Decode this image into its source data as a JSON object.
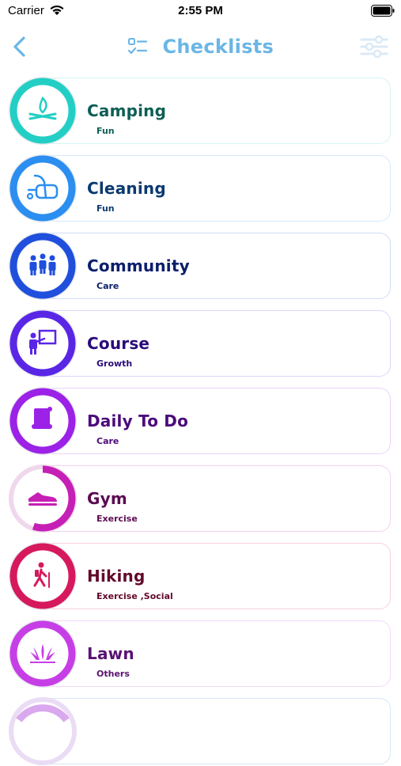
{
  "status": {
    "carrier": "Carrier",
    "time": "2:55 PM"
  },
  "nav": {
    "title": "Checklists"
  },
  "items": [
    {
      "name": "Camping",
      "category": "Fun",
      "color": "#23cfc4",
      "text_color": "#0d5f55",
      "icon": "campfire-icon",
      "progress": 1.0
    },
    {
      "name": "Cleaning",
      "category": "Fun",
      "color": "#2b8ef0",
      "text_color": "#0b3a70",
      "icon": "vacuum-icon",
      "progress": 1.0
    },
    {
      "name": "Community",
      "category": "Care",
      "color": "#1f4fdc",
      "text_color": "#0a1f6b",
      "icon": "people-icon",
      "progress": 1.0
    },
    {
      "name": "Course",
      "category": "Growth",
      "color": "#5a26e6",
      "text_color": "#2a0b7a",
      "icon": "teacher-icon",
      "progress": 1.0
    },
    {
      "name": "Daily To Do",
      "category": "Care",
      "color": "#9b22e6",
      "text_color": "#4c0b7a",
      "icon": "scroll-icon",
      "progress": 1.0
    },
    {
      "name": "Gym",
      "category": "Exercise",
      "color": "#c51fb5",
      "text_color": "#5c0b52",
      "icon": "sneaker-icon",
      "progress": 0.55
    },
    {
      "name": "Hiking",
      "category": "Exercise ,Social",
      "color": "#d6195c",
      "text_color": "#62092a",
      "icon": "hiker-icon",
      "progress": 1.0
    },
    {
      "name": "Lawn",
      "category": "Others",
      "color": "#c63ee6",
      "text_color": "#5a1270",
      "icon": "grass-icon",
      "progress": 1.0
    }
  ]
}
